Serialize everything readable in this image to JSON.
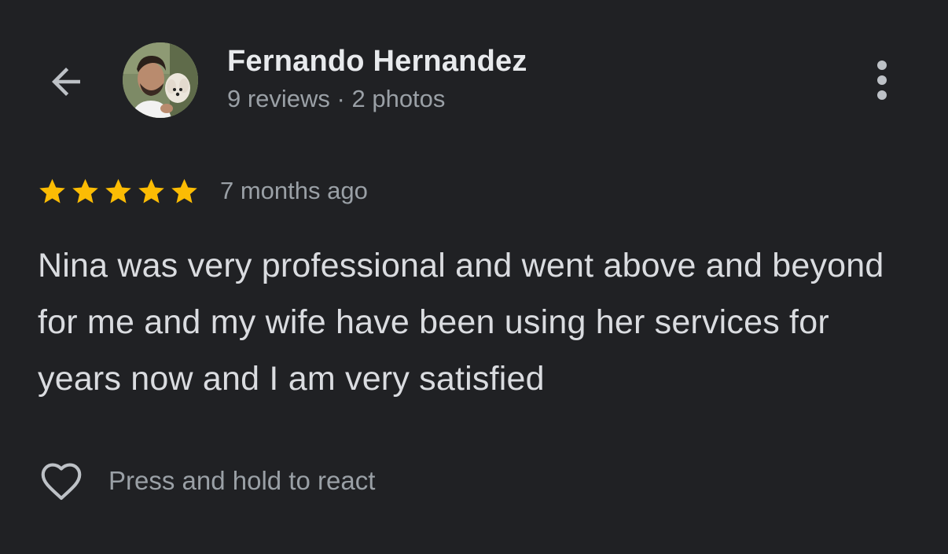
{
  "header": {
    "back_icon": "arrow-left-icon",
    "reviewer_name": "Fernando Hernandez",
    "reviewer_meta": "9 reviews · 2 photos",
    "more_icon": "more-vertical-icon"
  },
  "review": {
    "rating": 5,
    "rating_max": 5,
    "star_color": "#fbbc04",
    "time_ago": "7 months ago",
    "text": "Nina was very professional and went above and beyond for me and my wife have been using her services for years now and I am very satisfied"
  },
  "reaction": {
    "icon": "heart-outline-icon",
    "label": "Press and hold to react"
  },
  "colors": {
    "background": "#202124",
    "primary_text": "#e8eaed",
    "secondary_text": "#9aa0a6",
    "icon": "#bdc1c6"
  }
}
